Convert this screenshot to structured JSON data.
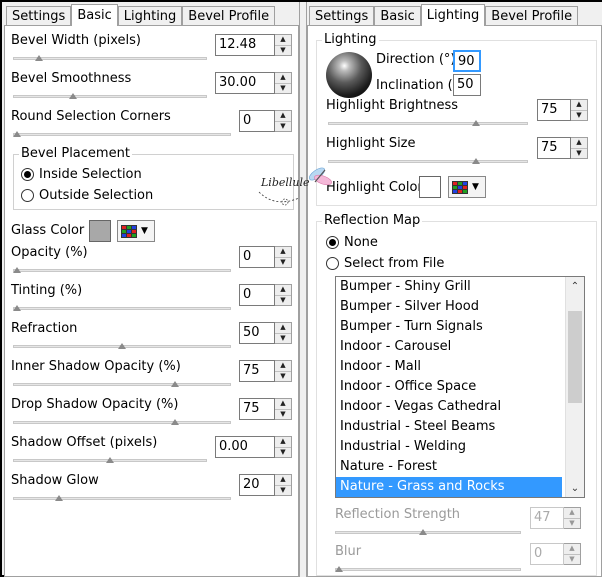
{
  "left_panel": {
    "tabs": [
      "Settings",
      "Basic",
      "Lighting",
      "Bevel Profile"
    ],
    "active_tab": "Basic",
    "bevel_width": {
      "label": "Bevel Width (pixels)",
      "value": "12.48",
      "slider_fraction": 0.12
    },
    "bevel_smoothness": {
      "label": "Bevel Smoothness",
      "value": "30.00",
      "slider_fraction": 0.3
    },
    "round_corners": {
      "label": "Round Selection Corners",
      "value": "0",
      "slider_fraction": 0.0
    },
    "bevel_placement": {
      "title": "Bevel Placement",
      "inside": "Inside Selection",
      "outside": "Outside Selection",
      "selected": "inside"
    },
    "glass_color": {
      "label": "Glass Color",
      "swatch": "#a8a8a8"
    },
    "opacity": {
      "label": "Opacity (%)",
      "value": "0",
      "slider_fraction": 0.0
    },
    "tinting": {
      "label": "Tinting (%)",
      "value": "0",
      "slider_fraction": 0.0
    },
    "refraction": {
      "label": "Refraction",
      "value": "50",
      "slider_fraction": 0.5
    },
    "inner_shadow": {
      "label": "Inner Shadow Opacity (%)",
      "value": "75",
      "slider_fraction": 0.75
    },
    "drop_shadow": {
      "label": "Drop Shadow Opacity (%)",
      "value": "75",
      "slider_fraction": 0.75
    },
    "shadow_offset": {
      "label": "Shadow Offset (pixels)",
      "value": "0.00",
      "slider_fraction": 0.5
    },
    "shadow_glow": {
      "label": "Shadow Glow",
      "value": "20",
      "slider_fraction": 0.2
    }
  },
  "right_panel": {
    "tabs": [
      "Settings",
      "Basic",
      "Lighting",
      "Bevel Profile"
    ],
    "active_tab": "Lighting",
    "lighting_group": "Lighting",
    "direction": {
      "label": "Direction (°)",
      "value": "90"
    },
    "inclination": {
      "label": "Inclination (°)",
      "value": "50"
    },
    "highlight_brightness": {
      "label": "Highlight Brightness",
      "value": "75",
      "slider_fraction": 0.75
    },
    "highlight_size": {
      "label": "Highlight Size",
      "value": "75",
      "slider_fraction": 0.75
    },
    "highlight_color": {
      "label": "Highlight Color",
      "swatch": "#ffffff"
    },
    "reflection_group": "Reflection Map",
    "none_label": "None",
    "from_file_label": "Select from File",
    "reflection_selected": "none",
    "reflection_items": [
      "Bumper - Shiny Grill",
      "Bumper - Silver Hood",
      "Bumper - Turn Signals",
      "Indoor - Carousel",
      "Indoor - Mall",
      "Indoor - Office Space",
      "Indoor - Vegas Cathedral",
      "Industrial - Steel Beams",
      "Industrial - Welding",
      "Nature - Forest",
      "Nature - Grass and Rocks"
    ],
    "selected_item": "Nature - Grass and Rocks",
    "reflection_strength": {
      "label": "Reflection Strength",
      "value": "47",
      "slider_fraction": 0.47
    },
    "blur": {
      "label": "Blur",
      "value": "0",
      "slider_fraction": 0.0
    }
  },
  "watermark": "Libellule"
}
